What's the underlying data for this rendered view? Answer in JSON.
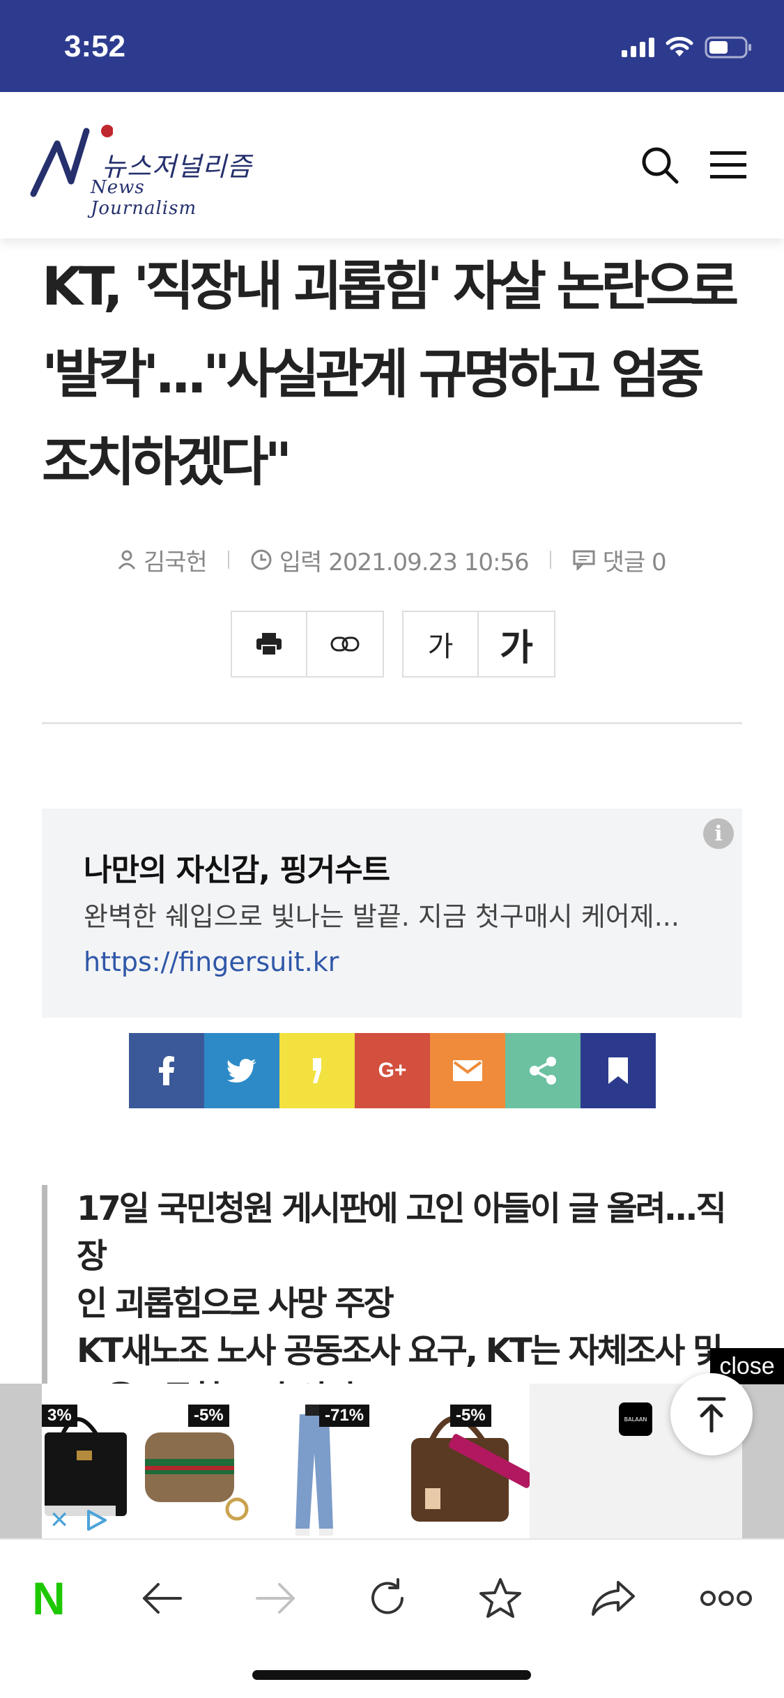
{
  "status_bar": {
    "time": "3:52"
  },
  "header": {
    "logo_kor": "뉴스저널리즘",
    "logo_eng": "News Journalism"
  },
  "article": {
    "title_lines": [
      "KT, '직장내 괴롭힘' 자살 논란으로",
      "'발칵'...\"사실관계 규명하고 엄중",
      "조치하겠다\""
    ],
    "author": "김국헌",
    "date": "입력 2021.09.23 10:56",
    "comments": "댓글 0",
    "font_small": "가",
    "font_big": "가",
    "summary_lines": [
      "17일 국민청원 게시판에 고인 아들이 글 올려...직장",
      "인 괴롭힘으로 사망 주장",
      "KT새노조 노사 공동조사 요구, KT는 자체조사 및",
      "고용노동청 조사 의뢰"
    ]
  },
  "ad": {
    "title": "나만의 자신감, 핑거수트",
    "description": "완벽한 쉐입으로 빛나는 발끝. 지금 첫구매시 케어제...",
    "url": "https://fingersuit.kr",
    "info": "i"
  },
  "share": {
    "items": [
      {
        "name": "facebook",
        "label": "f",
        "color": "#3b5998"
      },
      {
        "name": "twitter",
        "label": "t",
        "color": "#2d8ac7"
      },
      {
        "name": "kakaostory",
        "label": "'",
        "color": "#f2e13f"
      },
      {
        "name": "googleplus",
        "label": "G+",
        "color": "#d34f3e"
      },
      {
        "name": "email",
        "label": "✉",
        "color": "#ef8b3a"
      },
      {
        "name": "share",
        "label": "share",
        "color": "#6cc1a0"
      },
      {
        "name": "bookmark",
        "label": "bookmark",
        "color": "#2b3a8c"
      }
    ]
  },
  "banner": {
    "discounts": [
      "3%",
      "-5%",
      "-71%",
      "-5%"
    ],
    "close": "close",
    "brand": "BALAAN"
  },
  "colors": {
    "status_bar": "#2d3b8f",
    "naver_green": "#1ec800",
    "link_blue": "#2f57a8"
  }
}
